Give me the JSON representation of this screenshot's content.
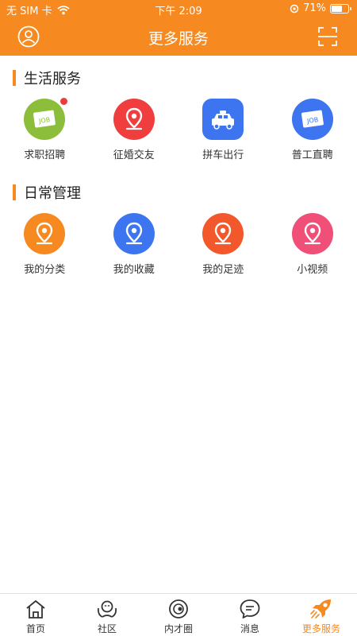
{
  "status_bar": {
    "carrier": "无 SIM 卡",
    "time": "下午 2:09",
    "battery_text": "71%",
    "battery_level": 0.71
  },
  "header": {
    "title": "更多服务",
    "left_icon": "user-icon",
    "right_icon": "scan-icon"
  },
  "colors": {
    "accent": "#f6891f",
    "text": "#222222",
    "badge": "#ee3a3a"
  },
  "sections": [
    {
      "title": "生活服务",
      "items": [
        {
          "label": "求职招聘",
          "icon": "job-card-icon",
          "color": "#8cbd3b",
          "badge": true
        },
        {
          "label": "征婚交友",
          "icon": "location-pin-icon",
          "color": "#f03e3e"
        },
        {
          "label": "拼车出行",
          "icon": "taxi-icon",
          "color": "#3d74f0"
        },
        {
          "label": "普工直聘",
          "icon": "job-card-icon",
          "color": "#3d74f0"
        }
      ]
    },
    {
      "title": "日常管理",
      "items": [
        {
          "label": "我的分类",
          "icon": "location-pin-icon",
          "color": "#f6891f"
        },
        {
          "label": "我的收藏",
          "icon": "location-pin-icon",
          "color": "#3d74f0"
        },
        {
          "label": "我的足迹",
          "icon": "location-pin-icon",
          "color": "#f2582c"
        },
        {
          "label": "小视频",
          "icon": "location-pin-icon",
          "color": "#f04f78"
        }
      ]
    }
  ],
  "tabbar": {
    "active_index": 4,
    "items": [
      {
        "label": "首页",
        "icon": "home-icon"
      },
      {
        "label": "社区",
        "icon": "community-icon"
      },
      {
        "label": "内才圈",
        "icon": "circle-icon"
      },
      {
        "label": "消息",
        "icon": "message-icon"
      },
      {
        "label": "更多服务",
        "icon": "rocket-icon"
      }
    ]
  }
}
